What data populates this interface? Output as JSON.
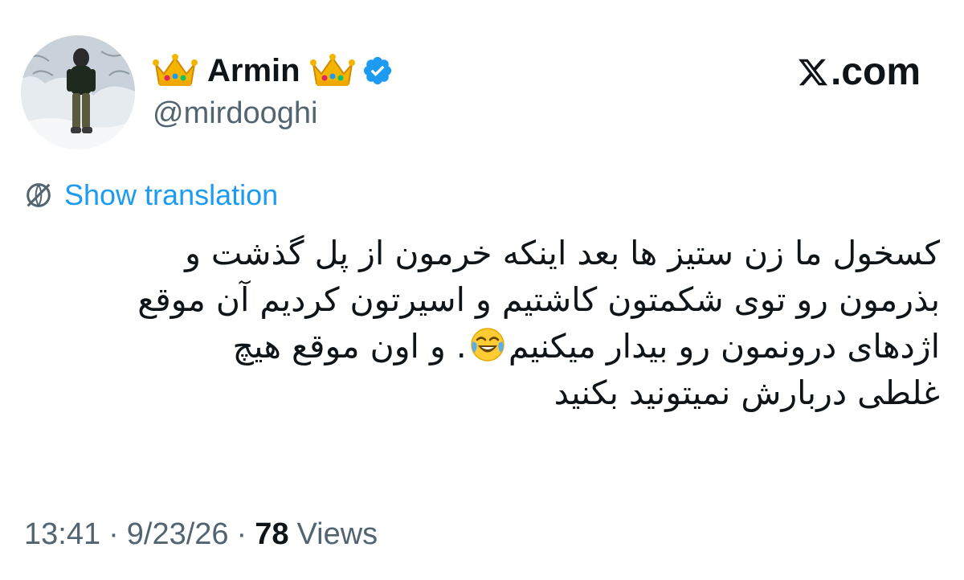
{
  "author": {
    "display_name": "Armin",
    "handle": "@mirdooghi",
    "badge": "verified-badge-icon",
    "name_decoration": "crown-emoji-icon"
  },
  "brand": {
    "logo": "x-logo-icon",
    "text": ".com"
  },
  "translation": {
    "icon": "globe-icon",
    "label": "Show translation"
  },
  "tweet": {
    "lines": [
      "کسخول ما زن ستیز ها بعد اینکه خرمون از پل گذشت و",
      "بذرمون رو توی شکمتون کاشتیم و اسیرتون کردیم آن موقع",
      "اژدهای درونمون رو بیدار میکنیم",
      ". و اون موقع هیچ",
      "غلطی دربارش نمیتونید بکنید"
    ],
    "emoji": "face-with-tears-of-joy-icon"
  },
  "meta": {
    "time": "13:41",
    "separator": "·",
    "date": "9/23/26",
    "views_count": "78",
    "views_label": "Views"
  },
  "colors": {
    "link_blue": "#1d9bf0",
    "verified_blue": "#1d9bf0",
    "secondary_text": "#536471",
    "primary_text": "#0f1419"
  }
}
